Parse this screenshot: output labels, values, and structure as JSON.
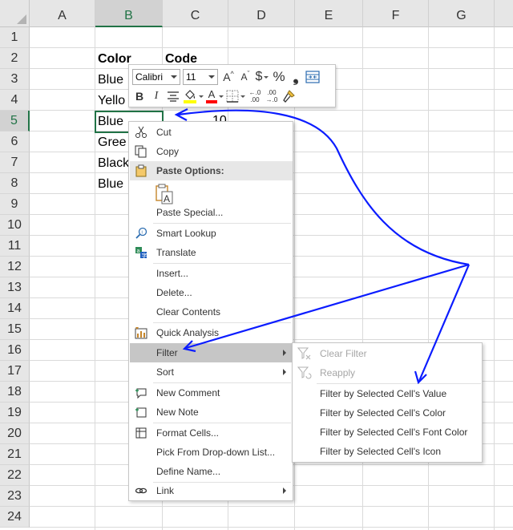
{
  "columns": [
    "A",
    "B",
    "C",
    "D",
    "E",
    "F",
    "G"
  ],
  "selected_column": "B",
  "rows": [
    "1",
    "2",
    "3",
    "4",
    "5",
    "6",
    "7",
    "8",
    "9",
    "10",
    "11",
    "12",
    "13",
    "14",
    "15",
    "16",
    "17",
    "18",
    "19",
    "20",
    "21",
    "22",
    "23",
    "24"
  ],
  "selected_row": "5",
  "cells": {
    "b2": "Color",
    "c2": "Code",
    "b3": "Blue",
    "b4": "Yello",
    "b5": "Blue",
    "c5": "10",
    "b6": "Gree",
    "b7": "Black",
    "b8": "Blue"
  },
  "mini_toolbar": {
    "font_name": "Calibri",
    "font_size": "11",
    "grow_font": "A",
    "shrink_font": "A",
    "currency": "$",
    "comma": "❟",
    "percent": "%",
    "bold": "B",
    "italic": "I",
    "font_color_label": "A",
    "decrease_decimal_a": "←.0",
    "decrease_decimal_b": ".00",
    "increase_decimal_a": ".00",
    "increase_decimal_b": "→.0"
  },
  "context_menu": {
    "cut": "Cut",
    "copy": "Copy",
    "paste_options": "Paste Options:",
    "paste_special": "Paste Special...",
    "smart_lookup": "Smart Lookup",
    "translate": "Translate",
    "insert": "Insert...",
    "delete": "Delete...",
    "clear_contents": "Clear Contents",
    "quick_analysis": "Quick Analysis",
    "filter": "Filter",
    "sort": "Sort",
    "new_comment": "New Comment",
    "new_note": "New Note",
    "format_cells": "Format Cells...",
    "pick_from_dropdown": "Pick From Drop-down List...",
    "define_name": "Define Name...",
    "link": "Link"
  },
  "filter_submenu": {
    "clear_filter": "Clear Filter",
    "reapply": "Reapply",
    "by_value": "Filter by Selected Cell's Value",
    "by_color": "Filter by Selected Cell's Color",
    "by_font_color": "Filter by Selected Cell's Font Color",
    "by_icon": "Filter by Selected Cell's Icon"
  },
  "colors": {
    "excel_green": "#217346",
    "annotation_blue": "#0b1cff",
    "highlight_yellow": "#ffff00",
    "font_red": "#ff0000"
  }
}
